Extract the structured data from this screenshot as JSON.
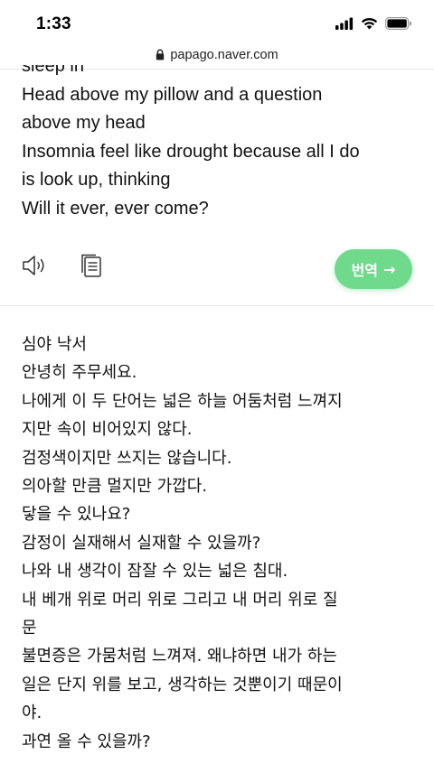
{
  "status_bar": {
    "time": "1:33",
    "icons": [
      "cellular-signal-icon",
      "wifi-icon",
      "battery-icon"
    ]
  },
  "url_bar": {
    "icon": "lock-icon",
    "url": "papago.naver.com"
  },
  "source_text": {
    "lines": [
      "sleep in",
      "Head above my pillow and a question",
      "above my head",
      "Insomnia feel like drought because all I do",
      "is look up, thinking",
      "Will it ever, ever come?"
    ]
  },
  "toolbar": {
    "speaker_icon": "speaker-icon",
    "copy_icon": "copy-icon",
    "translate_label": "번역",
    "translate_arrow": "→",
    "accent_color": "#6fd98c"
  },
  "target_text": {
    "lines": [
      "심야 낙서",
      "안녕히 주무세요.",
      "나에게 이 두 단어는 넓은 하늘 어둠처럼 느껴지",
      "지만 속이 비어있지 않다.",
      "검정색이지만 쓰지는 않습니다.",
      "의아할 만큼 멀지만 가깝다.",
      "닿을 수 있나요?",
      "감정이 실재해서 실재할 수 있을까?",
      "나와 내 생각이 잠잘 수 있는 넓은 침대.",
      "내 베개 위로 머리 위로 그리고 내 머리 위로 질",
      "문",
      "불면증은 가뭄처럼 느껴져. 왜냐하면 내가 하는",
      "일은 단지 위를 보고, 생각하는 것뿐이기 때문이",
      "야.",
      "과연 올 수 있을까?"
    ]
  }
}
